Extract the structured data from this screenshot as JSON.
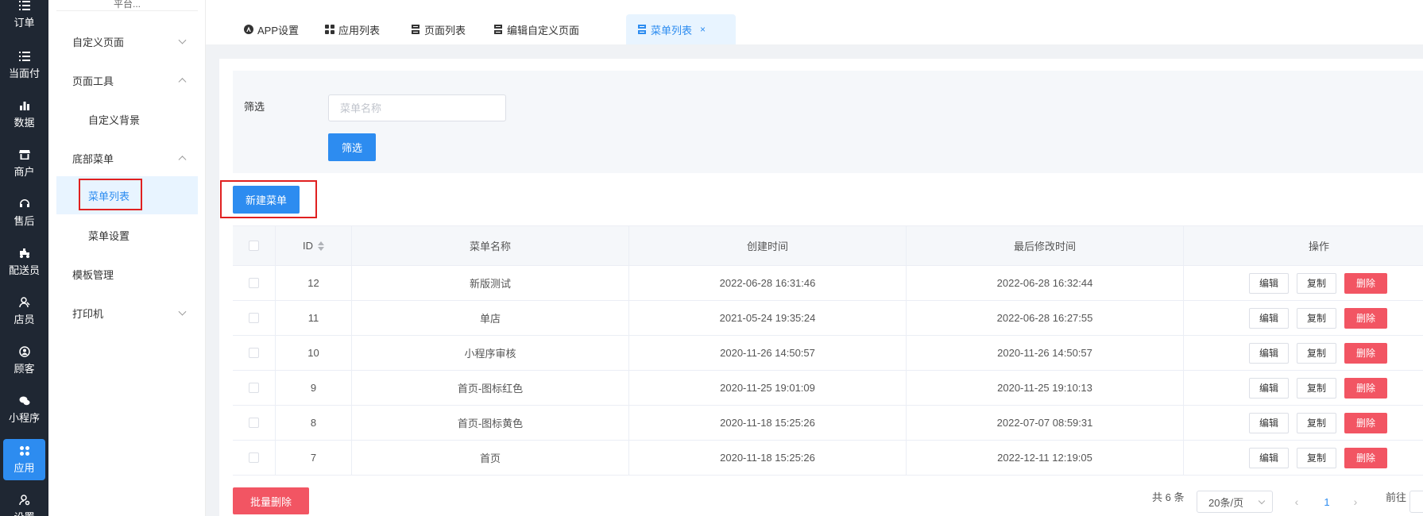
{
  "rail": {
    "items": [
      {
        "label": "订单",
        "icon": "list-icon"
      },
      {
        "label": "当面付",
        "icon": "list-icon"
      },
      {
        "label": "数据",
        "icon": "bar-chart-icon"
      },
      {
        "label": "商户",
        "icon": "store-icon"
      },
      {
        "label": "售后",
        "icon": "headset-icon"
      },
      {
        "label": "配送员",
        "icon": "delivery-icon"
      },
      {
        "label": "店员",
        "icon": "staff-icon"
      },
      {
        "label": "顾客",
        "icon": "customer-icon"
      },
      {
        "label": "小程序",
        "icon": "wechat-icon"
      },
      {
        "label": "应用",
        "icon": "apps-icon"
      },
      {
        "label": "设置",
        "icon": "settings-icon"
      }
    ],
    "active_label": "应用",
    "accent": "#2d8cf0"
  },
  "sidebar": {
    "top_text": "平台...",
    "groups": [
      {
        "label": "自定义页面",
        "state": "collapsed"
      },
      {
        "label": "页面工具",
        "state": "expanded"
      },
      {
        "label": "底部菜单",
        "state": "expanded"
      },
      {
        "label": "模板管理"
      },
      {
        "label": "打印机",
        "state": "collapsed"
      }
    ],
    "subs": [
      {
        "label": "自定义背景"
      },
      {
        "label": "菜单列表",
        "active": true
      },
      {
        "label": "菜单设置"
      }
    ]
  },
  "tabs": [
    {
      "label": "APP设置",
      "icon": "app-store-icon"
    },
    {
      "label": "应用列表",
      "icon": "grid-icon"
    },
    {
      "label": "页面列表",
      "icon": "page-icon"
    },
    {
      "label": "编辑自定义页面",
      "icon": "page-icon"
    },
    {
      "label": "菜单列表",
      "icon": "page-icon",
      "active": true,
      "close": "×"
    }
  ],
  "filter": {
    "label": "筛选",
    "placeholder": "菜单名称",
    "value": "",
    "button": "筛选"
  },
  "toolbar": {
    "new_button": "新建菜单",
    "batch_delete": "批量删除"
  },
  "table": {
    "headers": [
      "ID",
      "菜单名称",
      "创建时间",
      "最后修改时间",
      "操作"
    ],
    "rows": [
      {
        "id": "12",
        "name": "新版测试",
        "created": "2022-06-28 16:31:46",
        "modified": "2022-06-28 16:32:44"
      },
      {
        "id": "11",
        "name": "单店",
        "created": "2021-05-24 19:35:24",
        "modified": "2022-06-28 16:27:55"
      },
      {
        "id": "10",
        "name": "小程序审核",
        "created": "2020-11-26 14:50:57",
        "modified": "2020-11-26 14:50:57"
      },
      {
        "id": "9",
        "name": "首页-图标红色",
        "created": "2020-11-25 19:01:09",
        "modified": "2020-11-25 19:10:13"
      },
      {
        "id": "8",
        "name": "首页-图标黄色",
        "created": "2020-11-18 15:25:26",
        "modified": "2022-07-07 08:59:31"
      },
      {
        "id": "7",
        "name": "首页",
        "created": "2020-11-18 15:25:26",
        "modified": "2022-12-11 12:19:05"
      }
    ],
    "actions": {
      "edit": "编辑",
      "copy": "复制",
      "delete": "删除"
    }
  },
  "pagination": {
    "total": "共 6 条",
    "page_size": "20条/页",
    "current_page": "1",
    "prev": "‹",
    "next": "›",
    "goto": "前往"
  },
  "colors": {
    "primary": "#2d8cf0",
    "danger": "#f25563",
    "highlight_box": "#e02020",
    "rail_bg": "#1f2733"
  }
}
